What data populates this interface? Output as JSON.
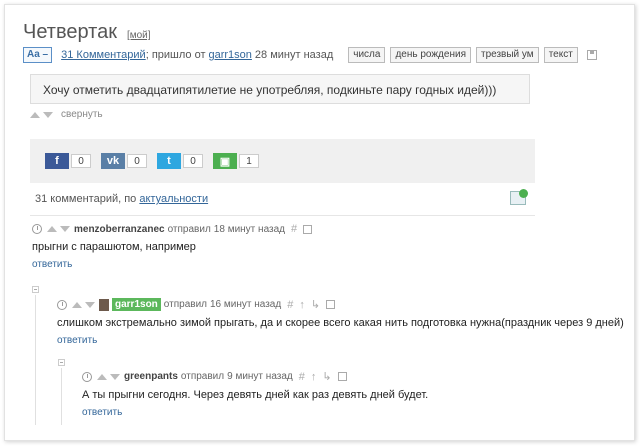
{
  "post": {
    "title": "Четвертак",
    "mine_label": "[мой]",
    "font_button": "Aa –",
    "comments_link": "31 Комментарий",
    "meta_text": "; пришло от",
    "author": "garr1son",
    "time": "28 минут назад",
    "tags": [
      "числа",
      "день рождения",
      "трезвый ум",
      "текст"
    ],
    "body": "Хочу отметить двадцатипятилетие не употребляя, подкиньте пару годных идей)))",
    "collapse_label": "свернуть"
  },
  "share": [
    {
      "icon": "facebook-icon",
      "glyph": "f",
      "count": "0",
      "color": "#3b5998"
    },
    {
      "icon": "vk-icon",
      "glyph": "vk",
      "count": "0",
      "color": "#5a7fa6"
    },
    {
      "icon": "twitter-icon",
      "glyph": "t",
      "count": "0",
      "color": "#2ea7e0"
    },
    {
      "icon": "save-icon",
      "glyph": "▣",
      "count": "1",
      "color": "#4caf50"
    }
  ],
  "comments_header": {
    "prefix": "31 комментарий, по",
    "sort": "актуальности"
  },
  "comments": [
    {
      "author": "menzoberranzanec",
      "action": "отправил",
      "time": "18 минут назад",
      "body": "прыгни с парашютом, например",
      "reply": "ответить"
    },
    {
      "author": "garr1son",
      "action": "отправил",
      "time": "16 минут назад",
      "body": "слишком экстремально зимой прыгать, да и скорее всего какая нить подготовка нужна(праздник через 9 дней)",
      "reply": "ответить"
    },
    {
      "author": "greenpants",
      "action": "отправил",
      "time": "9 минут назад",
      "body": "А ты прыгни сегодня. Через девять дней как раз девять дней будет.",
      "reply": "ответить"
    }
  ],
  "colors": {
    "accent": "#336699",
    "highlight_author": "#5cb85c"
  }
}
